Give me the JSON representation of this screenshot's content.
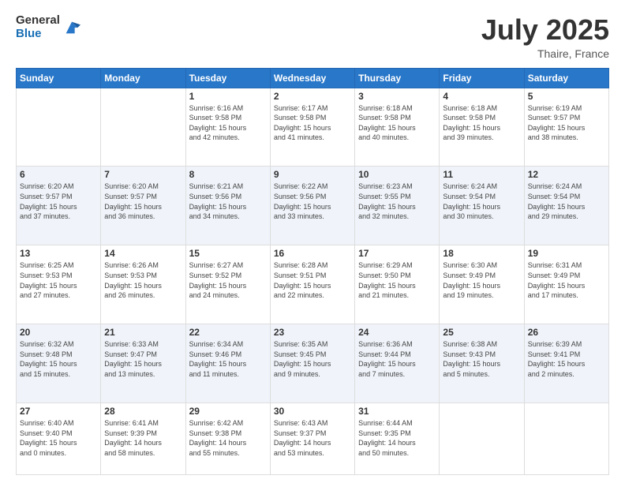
{
  "logo": {
    "general": "General",
    "blue": "Blue"
  },
  "title": {
    "month": "July 2025",
    "location": "Thaire, France"
  },
  "headers": [
    "Sunday",
    "Monday",
    "Tuesday",
    "Wednesday",
    "Thursday",
    "Friday",
    "Saturday"
  ],
  "weeks": [
    [
      {
        "day": "",
        "info": ""
      },
      {
        "day": "",
        "info": ""
      },
      {
        "day": "1",
        "info": "Sunrise: 6:16 AM\nSunset: 9:58 PM\nDaylight: 15 hours\nand 42 minutes."
      },
      {
        "day": "2",
        "info": "Sunrise: 6:17 AM\nSunset: 9:58 PM\nDaylight: 15 hours\nand 41 minutes."
      },
      {
        "day": "3",
        "info": "Sunrise: 6:18 AM\nSunset: 9:58 PM\nDaylight: 15 hours\nand 40 minutes."
      },
      {
        "day": "4",
        "info": "Sunrise: 6:18 AM\nSunset: 9:58 PM\nDaylight: 15 hours\nand 39 minutes."
      },
      {
        "day": "5",
        "info": "Sunrise: 6:19 AM\nSunset: 9:57 PM\nDaylight: 15 hours\nand 38 minutes."
      }
    ],
    [
      {
        "day": "6",
        "info": "Sunrise: 6:20 AM\nSunset: 9:57 PM\nDaylight: 15 hours\nand 37 minutes."
      },
      {
        "day": "7",
        "info": "Sunrise: 6:20 AM\nSunset: 9:57 PM\nDaylight: 15 hours\nand 36 minutes."
      },
      {
        "day": "8",
        "info": "Sunrise: 6:21 AM\nSunset: 9:56 PM\nDaylight: 15 hours\nand 34 minutes."
      },
      {
        "day": "9",
        "info": "Sunrise: 6:22 AM\nSunset: 9:56 PM\nDaylight: 15 hours\nand 33 minutes."
      },
      {
        "day": "10",
        "info": "Sunrise: 6:23 AM\nSunset: 9:55 PM\nDaylight: 15 hours\nand 32 minutes."
      },
      {
        "day": "11",
        "info": "Sunrise: 6:24 AM\nSunset: 9:54 PM\nDaylight: 15 hours\nand 30 minutes."
      },
      {
        "day": "12",
        "info": "Sunrise: 6:24 AM\nSunset: 9:54 PM\nDaylight: 15 hours\nand 29 minutes."
      }
    ],
    [
      {
        "day": "13",
        "info": "Sunrise: 6:25 AM\nSunset: 9:53 PM\nDaylight: 15 hours\nand 27 minutes."
      },
      {
        "day": "14",
        "info": "Sunrise: 6:26 AM\nSunset: 9:53 PM\nDaylight: 15 hours\nand 26 minutes."
      },
      {
        "day": "15",
        "info": "Sunrise: 6:27 AM\nSunset: 9:52 PM\nDaylight: 15 hours\nand 24 minutes."
      },
      {
        "day": "16",
        "info": "Sunrise: 6:28 AM\nSunset: 9:51 PM\nDaylight: 15 hours\nand 22 minutes."
      },
      {
        "day": "17",
        "info": "Sunrise: 6:29 AM\nSunset: 9:50 PM\nDaylight: 15 hours\nand 21 minutes."
      },
      {
        "day": "18",
        "info": "Sunrise: 6:30 AM\nSunset: 9:49 PM\nDaylight: 15 hours\nand 19 minutes."
      },
      {
        "day": "19",
        "info": "Sunrise: 6:31 AM\nSunset: 9:49 PM\nDaylight: 15 hours\nand 17 minutes."
      }
    ],
    [
      {
        "day": "20",
        "info": "Sunrise: 6:32 AM\nSunset: 9:48 PM\nDaylight: 15 hours\nand 15 minutes."
      },
      {
        "day": "21",
        "info": "Sunrise: 6:33 AM\nSunset: 9:47 PM\nDaylight: 15 hours\nand 13 minutes."
      },
      {
        "day": "22",
        "info": "Sunrise: 6:34 AM\nSunset: 9:46 PM\nDaylight: 15 hours\nand 11 minutes."
      },
      {
        "day": "23",
        "info": "Sunrise: 6:35 AM\nSunset: 9:45 PM\nDaylight: 15 hours\nand 9 minutes."
      },
      {
        "day": "24",
        "info": "Sunrise: 6:36 AM\nSunset: 9:44 PM\nDaylight: 15 hours\nand 7 minutes."
      },
      {
        "day": "25",
        "info": "Sunrise: 6:38 AM\nSunset: 9:43 PM\nDaylight: 15 hours\nand 5 minutes."
      },
      {
        "day": "26",
        "info": "Sunrise: 6:39 AM\nSunset: 9:41 PM\nDaylight: 15 hours\nand 2 minutes."
      }
    ],
    [
      {
        "day": "27",
        "info": "Sunrise: 6:40 AM\nSunset: 9:40 PM\nDaylight: 15 hours\nand 0 minutes."
      },
      {
        "day": "28",
        "info": "Sunrise: 6:41 AM\nSunset: 9:39 PM\nDaylight: 14 hours\nand 58 minutes."
      },
      {
        "day": "29",
        "info": "Sunrise: 6:42 AM\nSunset: 9:38 PM\nDaylight: 14 hours\nand 55 minutes."
      },
      {
        "day": "30",
        "info": "Sunrise: 6:43 AM\nSunset: 9:37 PM\nDaylight: 14 hours\nand 53 minutes."
      },
      {
        "day": "31",
        "info": "Sunrise: 6:44 AM\nSunset: 9:35 PM\nDaylight: 14 hours\nand 50 minutes."
      },
      {
        "day": "",
        "info": ""
      },
      {
        "day": "",
        "info": ""
      }
    ]
  ]
}
